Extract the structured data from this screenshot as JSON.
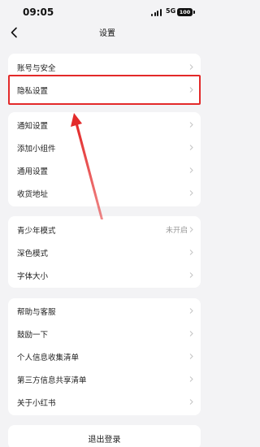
{
  "status_bar": {
    "time": "09:05",
    "network": "5G",
    "battery": "100"
  },
  "nav": {
    "title": "设置"
  },
  "groups": [
    {
      "items": [
        {
          "label": "账号与安全",
          "value": ""
        },
        {
          "label": "隐私设置",
          "value": ""
        }
      ]
    },
    {
      "items": [
        {
          "label": "通知设置",
          "value": ""
        },
        {
          "label": "添加小组件",
          "value": ""
        },
        {
          "label": "通用设置",
          "value": ""
        },
        {
          "label": "收货地址",
          "value": ""
        }
      ]
    },
    {
      "items": [
        {
          "label": "青少年模式",
          "value": "未开启"
        },
        {
          "label": "深色模式",
          "value": ""
        },
        {
          "label": "字体大小",
          "value": ""
        }
      ]
    },
    {
      "items": [
        {
          "label": "帮助与客服",
          "value": ""
        },
        {
          "label": "鼓励一下",
          "value": ""
        },
        {
          "label": "个人信息收集清单",
          "value": ""
        },
        {
          "label": "第三方信息共享清单",
          "value": ""
        },
        {
          "label": "关于小红书",
          "value": ""
        }
      ]
    }
  ],
  "logout": {
    "label": "退出登录"
  },
  "colors": {
    "highlight": "#e32a2a",
    "background": "#f3f3f5"
  }
}
